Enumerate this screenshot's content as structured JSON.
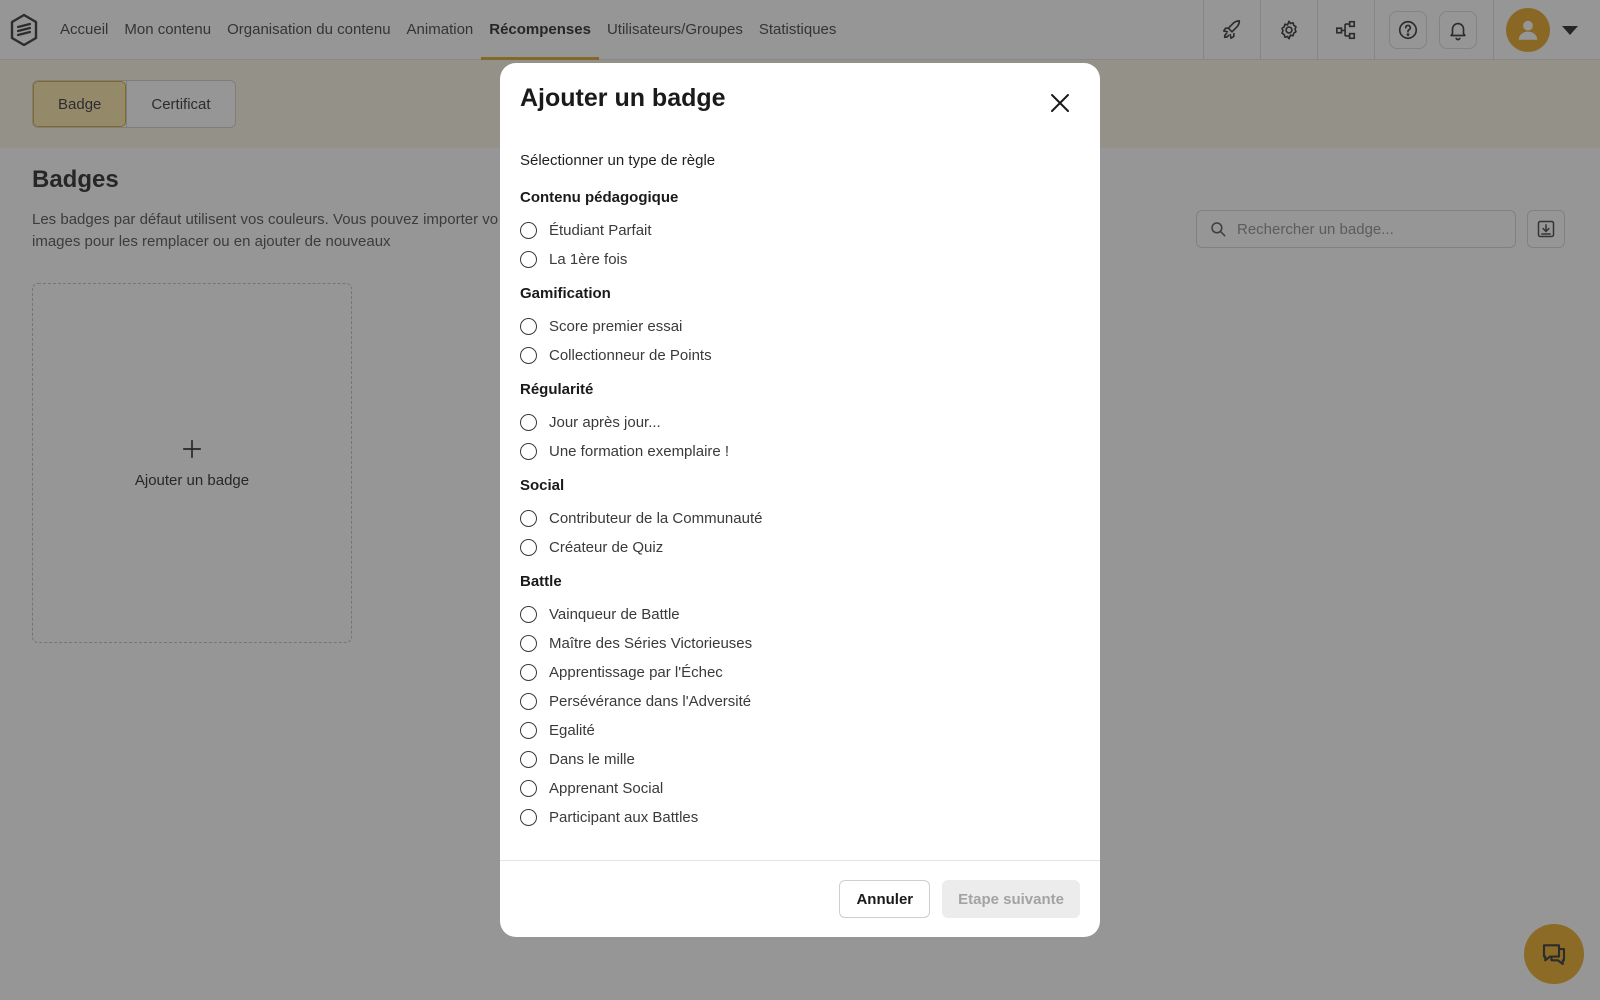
{
  "nav": {
    "items": [
      {
        "label": "Accueil",
        "active": false
      },
      {
        "label": "Mon contenu",
        "active": false
      },
      {
        "label": "Organisation du contenu",
        "active": false
      },
      {
        "label": "Animation",
        "active": false
      },
      {
        "label": "Récompenses",
        "active": true
      },
      {
        "label": "Utilisateurs/Groupes",
        "active": false
      },
      {
        "label": "Statistiques",
        "active": false
      }
    ],
    "icons": [
      "rocket-icon",
      "gear-icon",
      "hierarchy-icon",
      "help-icon",
      "bell-icon",
      "user-icon",
      "caret-down-icon"
    ]
  },
  "subheader": {
    "tabs": [
      {
        "label": "Badge",
        "active": true
      },
      {
        "label": "Certificat",
        "active": false
      }
    ]
  },
  "page": {
    "title": "Badges",
    "description_line1": "Les badges par défaut utilisent vos couleurs. Vous pouvez importer vo",
    "description_line2": "images pour les remplacer ou en ajouter de nouveaux",
    "search_placeholder": "Rechercher un badge...",
    "add_card_label": "Ajouter un badge"
  },
  "modal": {
    "title": "Ajouter un badge",
    "prompt": "Sélectionner un type de règle",
    "groups": [
      {
        "title": "Contenu pédagogique",
        "options": [
          "Étudiant Parfait",
          "La 1ère fois"
        ]
      },
      {
        "title": "Gamification",
        "options": [
          "Score premier essai",
          "Collectionneur de Points"
        ]
      },
      {
        "title": "Régularité",
        "options": [
          "Jour après jour...",
          "Une formation exemplaire !"
        ]
      },
      {
        "title": "Social",
        "options": [
          "Contributeur de la Communauté",
          "Créateur de Quiz"
        ]
      },
      {
        "title": "Battle",
        "options": [
          "Vainqueur de Battle",
          "Maître des Séries Victorieuses",
          "Apprentissage par l'Échec",
          "Persévérance dans l'Adversité",
          "Egalité",
          "Dans le mille",
          "Apprenant Social",
          "Participant aux Battles"
        ]
      }
    ],
    "cancel_label": "Annuler",
    "next_label": "Etape suivante"
  },
  "colors": {
    "accent": "#e2a21b",
    "active_tab_bg": "#fbe7a7",
    "overlay": "rgba(45,45,45,0.5)"
  }
}
